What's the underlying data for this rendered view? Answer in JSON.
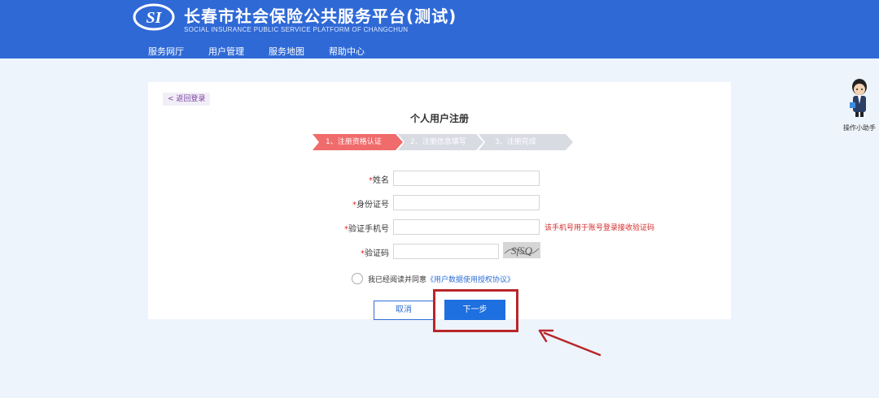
{
  "header": {
    "title": "长春市社会保险公共服务平台(测试)",
    "subtitle": "SOCIAL INSURANCE PUBLIC SERVICE PLATFORM OF CHANGCHUN",
    "logo_text": "SI",
    "nav": [
      "服务网厅",
      "用户管理",
      "服务地图",
      "帮助中心"
    ]
  },
  "helper": {
    "label": "操作小助手"
  },
  "main": {
    "back_label": "< 返回登录",
    "title": "个人用户注册",
    "steps": [
      "1、注册资格认证",
      "2、注册信息填写",
      "3、注册完成"
    ],
    "active_step_color": "#f06b6b",
    "inactive_step_color": "#d9dbe3"
  },
  "form": {
    "fields": [
      {
        "required_mark": "*",
        "label": "姓名",
        "value": ""
      },
      {
        "required_mark": "*",
        "label": "身份证号",
        "value": ""
      },
      {
        "required_mark": "*",
        "label": "验证手机号",
        "value": ""
      },
      {
        "required_mark": "*",
        "label": "验证码",
        "value": ""
      }
    ],
    "phone_hint": "该手机号用于账号登录接收验证码",
    "captcha_text": "SfSQ",
    "agree_text": "我已经阅读并同意",
    "agree_link": "《用户数据使用授权协议》",
    "cancel_label": "取消",
    "next_label": "下一步"
  },
  "colors": {
    "header_bg": "#2f69d6",
    "primary": "#1e6fe0",
    "annotation": "#b8262a"
  }
}
